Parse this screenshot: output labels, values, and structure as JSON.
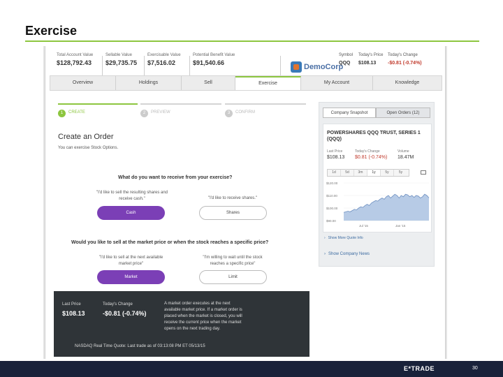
{
  "slide": {
    "title": "Exercise",
    "page_number": "30",
    "brand": "E*TRADE"
  },
  "accent_colors": {
    "green": "#8dc63f",
    "purple": "#7b3fb6",
    "negative": "#c0392b",
    "footer": "#19223a"
  },
  "account": [
    {
      "label": "Total Account Value",
      "value": "$128,792.43"
    },
    {
      "label": "Sellable Value",
      "value": "$29,735.75"
    },
    {
      "label": "Exercisable Value",
      "value": "$7,516.02"
    },
    {
      "label": "Potential Benefit Value",
      "value": "$91,540.66"
    }
  ],
  "company": {
    "logo_text": "DemoCorp",
    "symbol_label": "Symbol",
    "symbol": "QQQ",
    "price_label": "Today's Price",
    "price": "$108.13",
    "change_label": "Today's Change",
    "change": "-$0.81 (-0.74%)"
  },
  "nav": [
    "Overview",
    "Holdings",
    "Sell",
    "Exercise",
    "My Account",
    "Knowledge"
  ],
  "nav_active": "Exercise",
  "steps": [
    {
      "num": "1",
      "label": "CREATE",
      "active": true
    },
    {
      "num": "2",
      "label": "PREVIEW",
      "active": false
    },
    {
      "num": "3",
      "label": "CONFIRM",
      "active": false
    }
  ],
  "order": {
    "title": "Create an Order",
    "subtitle": "You can exercise Stock Options.",
    "q1": "What do you want to receive from your exercise?",
    "opt_cash_text": "\"I'd like to sell the resulting shares and receive cash.\"",
    "opt_shares_text": "\"I'd like to receive shares.\"",
    "btn_cash": "Cash",
    "btn_shares": "Shares",
    "q2": "Would you like to sell at the market price or when the stock reaches a specific price?",
    "opt_market_text": "\"I'd like to sell at the next available market price\"",
    "opt_limit_text": "\"I'm willing to wait until the stock reaches a specific price\"",
    "btn_market": "Market",
    "btn_limit": "Limit"
  },
  "info_panel": {
    "last_price_label": "Last Price",
    "last_price": "$108.13",
    "change_label": "Today's Change",
    "change": "-$0.81 (-0.74%)",
    "description": "A market order executes at the next available market price. If a market order is placed when the market is closed, you will receive the current price when the market opens on the next trading day.",
    "footer": "NASDAQ Real Time Quote: Last trade as of 03:13:08 PM ET 05/13/15"
  },
  "side_panel": {
    "tab_snapshot": "Company Snapshot",
    "tab_orders": "Open Orders (12)",
    "name": "POWERSHARES QQQ TRUST, SERIES 1 (QQQ)",
    "last_price_label": "Last Price",
    "last_price": "$108.13",
    "change_label": "Today's Change",
    "change": "$0.81 (-0.74%)",
    "volume_label": "Volume",
    "volume": "18.47M",
    "ranges": [
      "1d",
      "5d",
      "3m",
      "1y",
      "5y",
      "5y"
    ],
    "range_selected": "1y",
    "link_quote": "Show More Quote Info",
    "link_news": "Show Company News"
  },
  "chart_data": {
    "type": "area",
    "yticks": [
      "$120.00",
      "$110.00",
      "$100.00",
      "$90.00"
    ],
    "ylim": [
      90,
      120
    ],
    "xticks": [
      "Jul '15",
      "Jan '15"
    ],
    "values": [
      96.5,
      97,
      97.5,
      97,
      98,
      99,
      98.5,
      100,
      101,
      100.5,
      102,
      103,
      102,
      104,
      105,
      106,
      105.5,
      107,
      108,
      107,
      109,
      110,
      108,
      109.5,
      111,
      110,
      108,
      110,
      109,
      111,
      110.5,
      109,
      110,
      108.5,
      110,
      109.5,
      108,
      109,
      111,
      110,
      108.13
    ]
  }
}
